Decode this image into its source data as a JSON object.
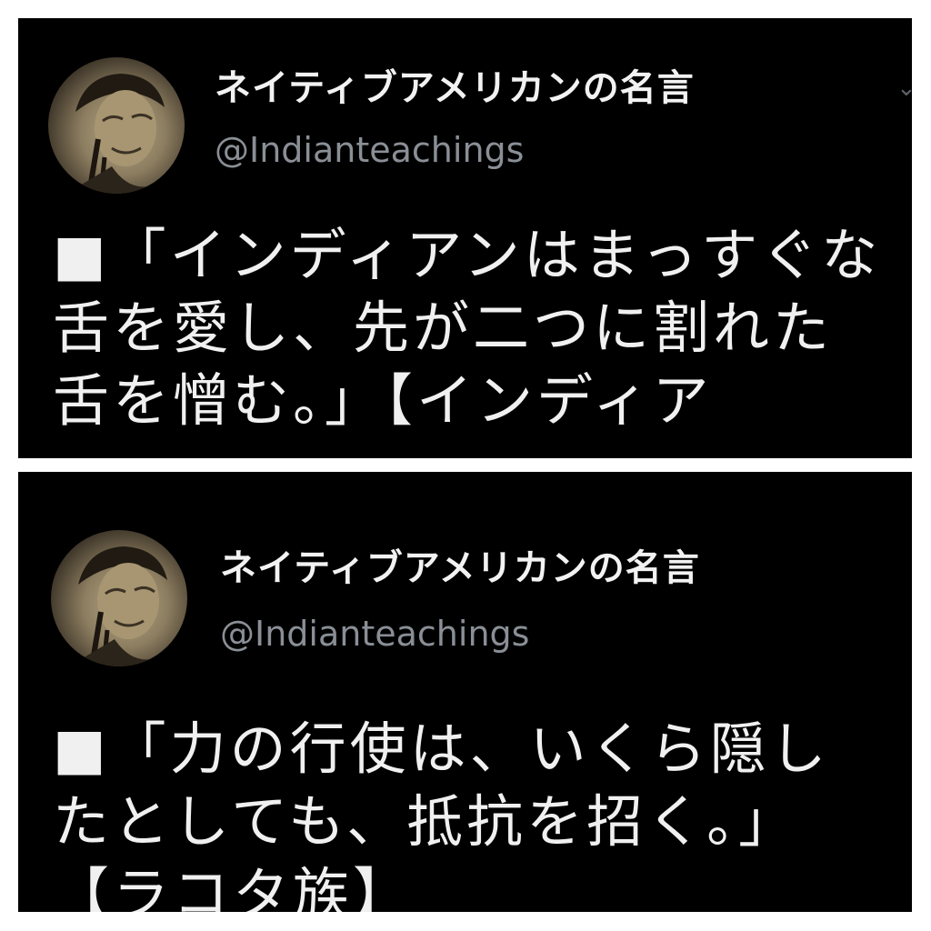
{
  "posts": [
    {
      "account": {
        "display_name": "ネイティブアメリカンの名言",
        "handle": "@Indianteachings",
        "avatar": "elder-portrait-avatar"
      },
      "menu_icon": "chevron-down-icon",
      "text": "■「インディアンはまっすぐな舌を愛し、先が二つに割れた舌を憎む。」【インディア"
    },
    {
      "account": {
        "display_name": "ネイティブアメリカンの名言",
        "handle": "@Indianteachings",
        "avatar": "elder-portrait-avatar"
      },
      "text": "■「力の行使は、いくら隠したとしても、抵抗を招く。」【ラコタ族】"
    }
  ],
  "colors": {
    "background": "#000000",
    "name_text": "#f2f2f2",
    "handle_text": "#8a8f96",
    "body_text": "#f0f0f0",
    "divider": "#ffffff"
  }
}
